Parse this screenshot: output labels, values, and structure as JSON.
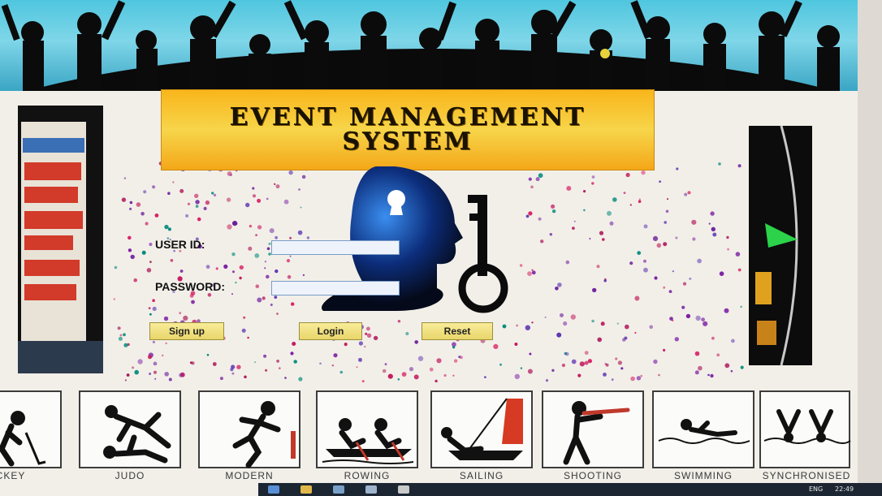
{
  "window": {
    "controls": "□"
  },
  "header": {
    "title_line1": "EVENT MANAGEMENT",
    "title_line2": "SYSTEM"
  },
  "login": {
    "user_id_label": "USER ID:",
    "password_label": "PASSWORD:",
    "user_id_value": "",
    "password_value": ""
  },
  "buttons": {
    "signup": "Sign up",
    "login": "Login",
    "reset": "Reset"
  },
  "sports": [
    {
      "label": "CKEY",
      "icon": "hockey-icon"
    },
    {
      "label": "JUDO",
      "icon": "judo-icon"
    },
    {
      "label": "MODERN",
      "icon": "modern-pentathlon-icon"
    },
    {
      "label": "ROWING",
      "icon": "rowing-icon"
    },
    {
      "label": "SAILING",
      "icon": "sailing-icon"
    },
    {
      "label": "SHOOTING",
      "icon": "shooting-icon"
    },
    {
      "label": "SWIMMING",
      "icon": "swimming-icon"
    },
    {
      "label": "SYNCHRONISED",
      "icon": "synchronised-swimming-icon"
    }
  ],
  "taskbar": {
    "language": "ENG",
    "time": "22:49"
  },
  "colors": {
    "title_bg": "#f7c12a",
    "button_bg": "#f1e27f",
    "banner_sky": "#4fc6df"
  }
}
